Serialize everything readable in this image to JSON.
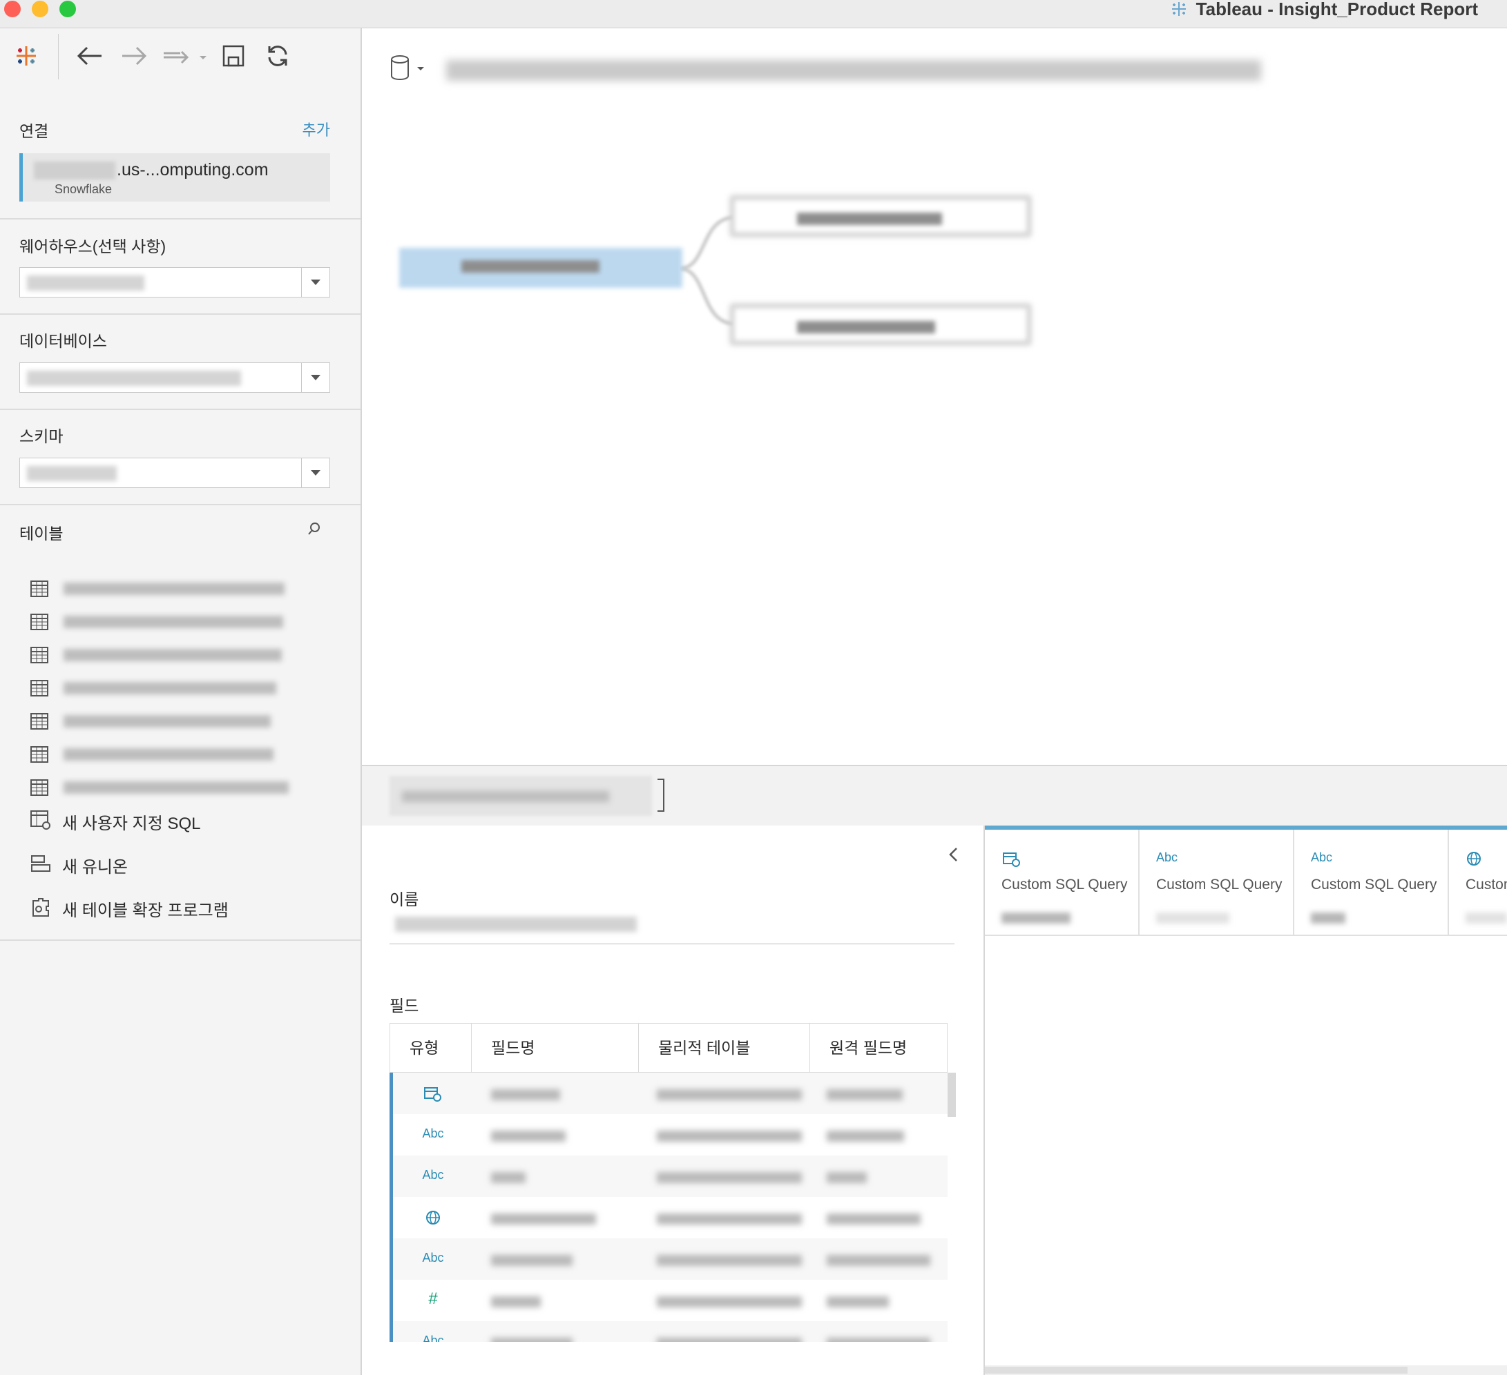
{
  "window": {
    "title": "Tableau - Insight_Product Report"
  },
  "sidebar": {
    "connection_label": "연결",
    "add_label": "추가",
    "connection": {
      "host_suffix": ".us-...omputing.com",
      "type": "Snowflake"
    },
    "warehouse_label": "웨어하우스(선택 사항)",
    "database_label": "데이터베이스",
    "schema_label": "스키마",
    "table_label": "테이블",
    "table_items": [
      {
        "icon": "table-grid-icon"
      },
      {
        "icon": "table-grid-icon"
      },
      {
        "icon": "table-grid-icon"
      },
      {
        "icon": "table-grid-icon"
      },
      {
        "icon": "table-grid-icon"
      },
      {
        "icon": "table-grid-icon"
      },
      {
        "icon": "table-grid-icon"
      }
    ],
    "actions": [
      {
        "label": "새 사용자 지정 SQL",
        "icon": "custom-sql-icon"
      },
      {
        "label": "새 유니온",
        "icon": "union-icon"
      },
      {
        "label": "새 테이블 확장 프로그램",
        "icon": "table-extension-icon"
      }
    ]
  },
  "meta_panel": {
    "name_label": "이름",
    "fields_label": "필드",
    "columns": [
      "유형",
      "필드명",
      "물리적 테이블",
      "원격 필드명"
    ],
    "rows": [
      {
        "type": "datetime"
      },
      {
        "type": "Abc"
      },
      {
        "type": "Abc"
      },
      {
        "type": "globe"
      },
      {
        "type": "Abc"
      },
      {
        "type": "#"
      },
      {
        "type": "Abc"
      }
    ]
  },
  "data_grid": {
    "columns": [
      {
        "type": "datetime",
        "source": "Custom SQL Query"
      },
      {
        "type": "Abc",
        "source": "Custom SQL Query"
      },
      {
        "type": "Abc",
        "source": "Custom SQL Query"
      },
      {
        "type": "globe",
        "source": "Custom SQL Query"
      }
    ]
  },
  "colors": {
    "accent": "#4aa3d3",
    "link": "#3a8fc0",
    "type_icon": "#2a8cb5",
    "number_icon": "#1aa37a"
  }
}
